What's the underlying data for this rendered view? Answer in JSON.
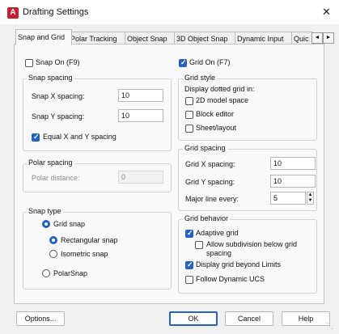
{
  "window": {
    "title": "Drafting Settings",
    "icon_name": "autocad-app-icon",
    "icon_letter": "A",
    "close_glyph": "✕"
  },
  "tabs": [
    {
      "label": "Snap and Grid",
      "active": true
    },
    {
      "label": "Polar Tracking"
    },
    {
      "label": "Object Snap"
    },
    {
      "label": "3D Object Snap"
    },
    {
      "label": "Dynamic Input"
    },
    {
      "label": "Quic"
    }
  ],
  "tab_scroll": {
    "left": "◄",
    "right": "►"
  },
  "snap_on": {
    "label": "Snap On (F9)",
    "checked": false
  },
  "snap_spacing": {
    "title": "Snap spacing",
    "x_label": "Snap X spacing:",
    "x_value": "10",
    "y_label": "Snap Y spacing:",
    "y_value": "10",
    "equal_label": "Equal X and Y spacing",
    "equal_checked": true
  },
  "polar_spacing": {
    "title": "Polar spacing",
    "distance_label": "Polar distance:",
    "distance_value": "0"
  },
  "snap_type": {
    "title": "Snap type",
    "grid_snap": "Grid snap",
    "rectangular": "Rectangular snap",
    "isometric": "Isometric snap",
    "polar": "PolarSnap"
  },
  "grid_on": {
    "label": "Grid On (F7)",
    "checked": true
  },
  "grid_style": {
    "title": "Grid style",
    "desc": "Display dotted grid in:",
    "model_space": "2D model space",
    "block_editor": "Block editor",
    "sheet_layout": "Sheet/layout"
  },
  "grid_spacing": {
    "title": "Grid spacing",
    "x_label": "Grid X spacing:",
    "x_value": "10",
    "y_label": "Grid Y spacing:",
    "y_value": "10",
    "major_label": "Major line every:",
    "major_value": "5"
  },
  "grid_behavior": {
    "title": "Grid behavior",
    "adaptive": "Adaptive grid",
    "subdivision_line1": "Allow subdivision below grid",
    "subdivision_line2": "spacing",
    "beyond_limits": "Display grid beyond Limits",
    "follow_ucs": "Follow Dynamic UCS"
  },
  "buttons": {
    "options": "Options...",
    "ok": "OK",
    "cancel": "Cancel",
    "help": "Help"
  },
  "colors": {
    "accent": "#2261c5",
    "app_icon": "#c8202e"
  }
}
